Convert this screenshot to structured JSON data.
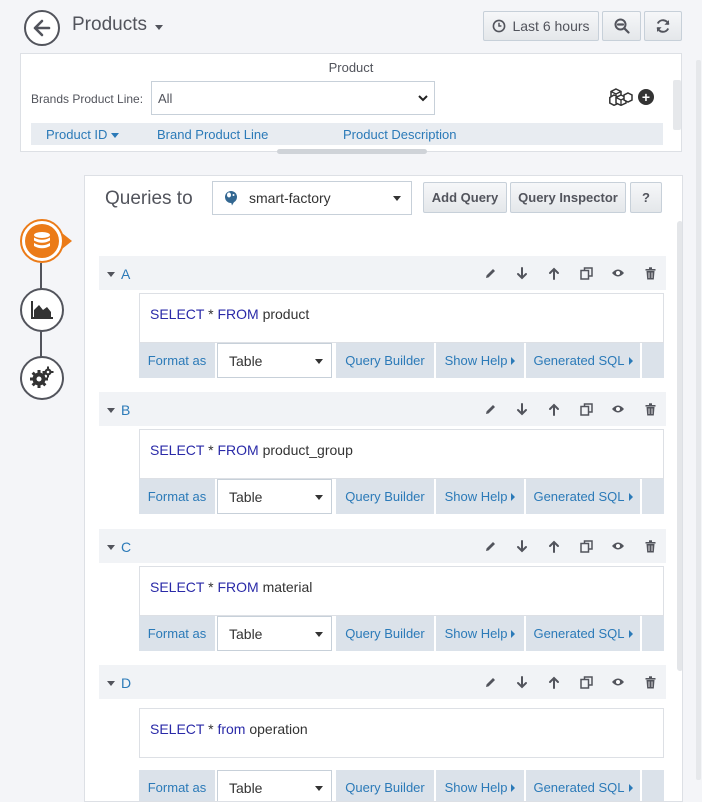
{
  "nav": {
    "title": "Products",
    "time_range": "Last 6 hours"
  },
  "panel": {
    "title": "Product",
    "variable_label": "Brands Product Line:",
    "variable_value": "All",
    "columns": [
      "Product ID",
      "Brand Product Line",
      "Product Description"
    ]
  },
  "editor": {
    "queries_to_label": "Queries to",
    "datasource": "smart-factory",
    "add_query": "Add Query",
    "query_inspector": "Query Inspector",
    "help": "?"
  },
  "queries": [
    {
      "ref": "A",
      "sql": {
        "select": "SELECT",
        "star": "*",
        "from": "FROM",
        "table": "product"
      },
      "format_label": "Format as",
      "format": "Table",
      "query_builder": "Query Builder",
      "show_help": "Show Help",
      "generated_sql": "Generated SQL"
    },
    {
      "ref": "B",
      "sql": {
        "select": "SELECT",
        "star": "*",
        "from": "FROM",
        "table": "product_group"
      },
      "format_label": "Format as",
      "format": "Table",
      "query_builder": "Query Builder",
      "show_help": "Show Help",
      "generated_sql": "Generated SQL"
    },
    {
      "ref": "C",
      "sql": {
        "select": "SELECT",
        "star": "*",
        "from": "FROM",
        "table": "material"
      },
      "format_label": "Format as",
      "format": "Table",
      "query_builder": "Query Builder",
      "show_help": "Show Help",
      "generated_sql": "Generated SQL"
    },
    {
      "ref": "D",
      "sql": {
        "select": "SELECT",
        "star": "*",
        "from": "from",
        "table": "operation"
      },
      "format_label": "Format as",
      "format": "Table",
      "query_builder": "Query Builder",
      "show_help": "Show Help",
      "generated_sql": "Generated SQL"
    }
  ],
  "rail": {
    "items": [
      "database-icon",
      "chart-area-icon",
      "cogs-icon"
    ],
    "active_color": "#eb7b18"
  }
}
